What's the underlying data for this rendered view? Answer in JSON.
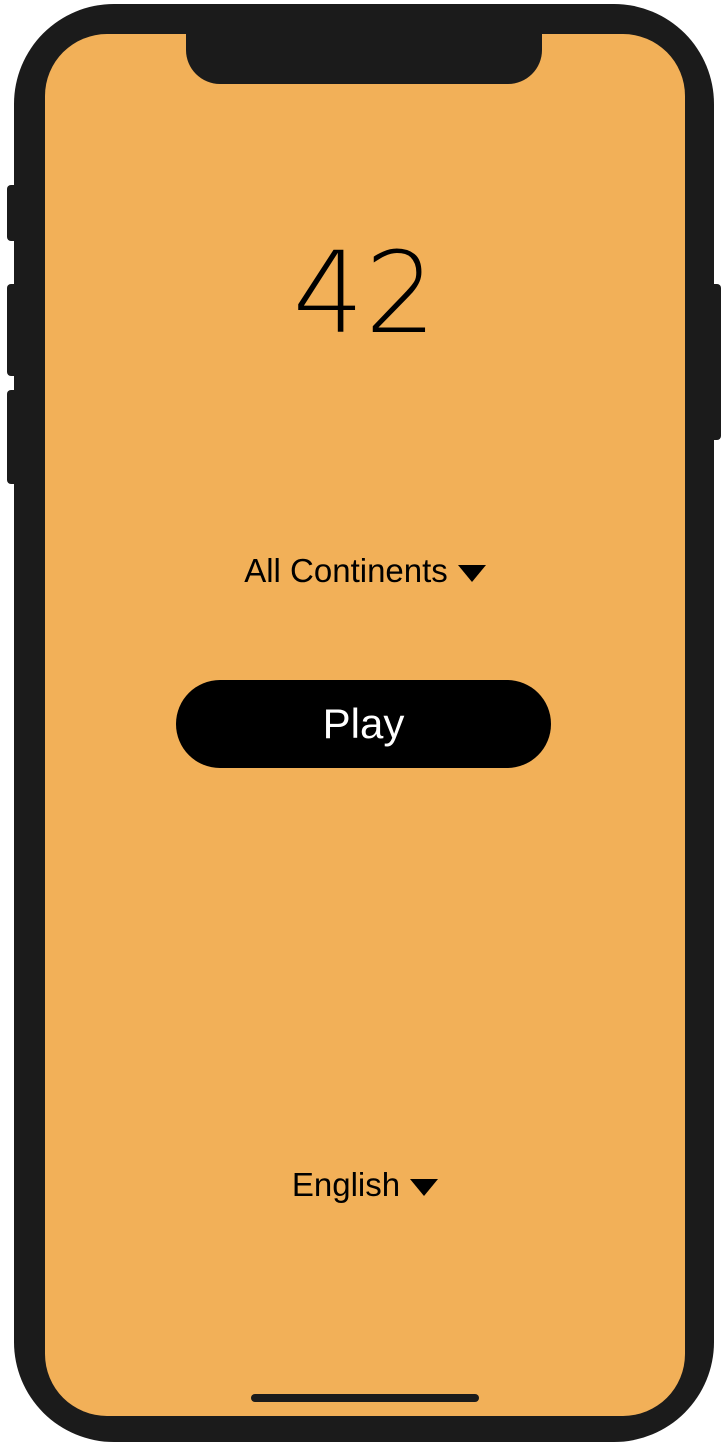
{
  "app": {
    "background_color": "#f2b058",
    "frame_color": "#1b1b1b"
  },
  "score": {
    "value": "42"
  },
  "continent_selector": {
    "selected": "All Continents",
    "icon": "caret-down-icon"
  },
  "play_button": {
    "label": "Play"
  },
  "language_selector": {
    "selected": "English",
    "icon": "caret-down-icon"
  }
}
